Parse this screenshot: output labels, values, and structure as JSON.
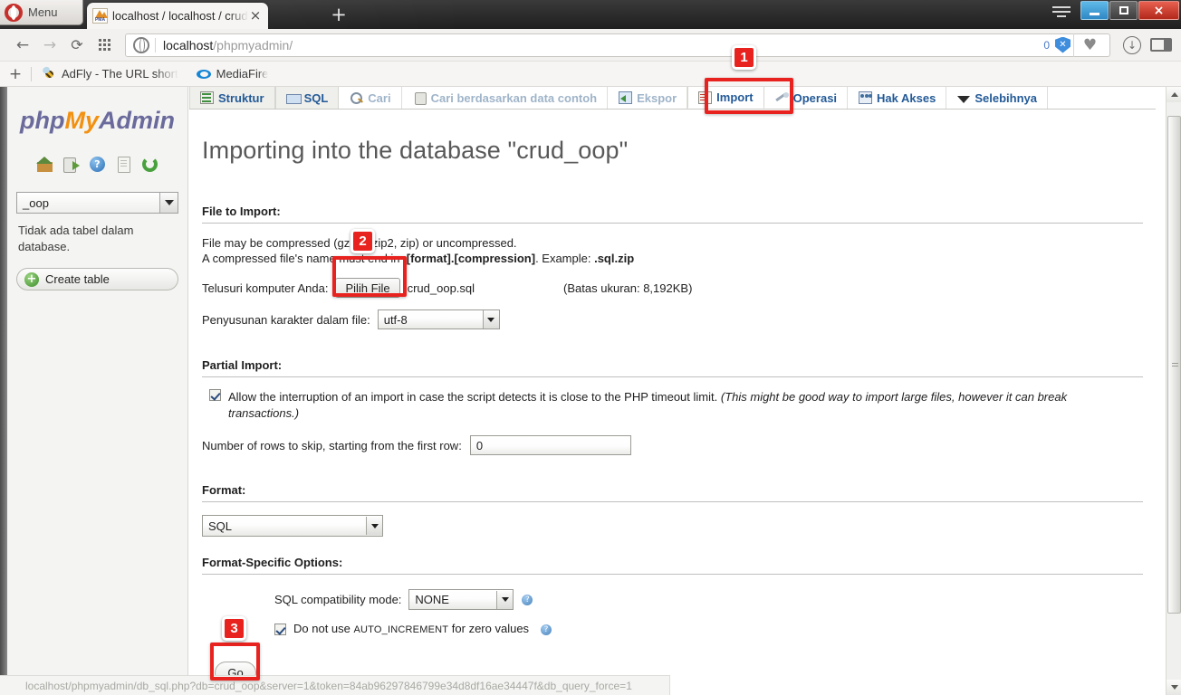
{
  "browser": {
    "menu_label": "Menu",
    "tab": {
      "title": "localhost / localhost / crud",
      "favicon": "phpmyadmin-favicon",
      "close": "×"
    },
    "new_tab": "+",
    "window_controls": {
      "minimize": "minimize-icon",
      "maximize": "maximize-icon",
      "close": "×"
    },
    "nav": {
      "back": "←",
      "forward": "→",
      "reload": "⟳",
      "speeddial": "grid-icon"
    },
    "address": {
      "host": "localhost",
      "path": "/phpmyadmin/",
      "blocked_count": "0",
      "shield": "✕"
    },
    "toolbar_right": {
      "bookmark": "♥",
      "download": "↓",
      "panel": "panel-icon"
    },
    "bookmarks": {
      "add": "+",
      "items": [
        {
          "label": "AdFly - The URL short",
          "icon": "adfly-bee-icon"
        },
        {
          "label": "MediaFire",
          "icon": "mediafire-icon"
        }
      ]
    },
    "statusbar_url": "localhost/phpmyadmin/db_sql.php?db=crud_oop&server=1&token=84ab96297846799e34d8df16ae34447f&db_query_force=1"
  },
  "sidebar": {
    "logo": {
      "php": "php",
      "my": "My",
      "admin": "Admin"
    },
    "icons": [
      {
        "name": "home-icon",
        "label": "Home"
      },
      {
        "name": "logout-icon",
        "label": "Log out"
      },
      {
        "name": "help-icon",
        "label": "?"
      },
      {
        "name": "documentation-icon",
        "label": "Documentation"
      },
      {
        "name": "reload-icon",
        "label": "Reload"
      }
    ],
    "database_select": "_oop",
    "no_tables_note": "Tidak ada tabel dalam database.",
    "create_table": "Create table"
  },
  "pma_tabs": [
    {
      "label": "Struktur",
      "icon": "structure-icon",
      "state": "inactive"
    },
    {
      "label": "SQL",
      "icon": "sql-icon",
      "state": "inactive"
    },
    {
      "label": "Cari",
      "icon": "search-icon",
      "state": "disabled"
    },
    {
      "label": "Cari berdasarkan data contoh",
      "icon": "query-by-example-icon",
      "state": "disabled"
    },
    {
      "label": "Ekspor",
      "icon": "export-icon",
      "state": "disabled"
    },
    {
      "label": "Import",
      "icon": "import-icon",
      "state": "active"
    },
    {
      "label": "Operasi",
      "icon": "operations-icon",
      "state": "disabled"
    },
    {
      "label": "Hak Akses",
      "icon": "privileges-icon",
      "state": "disabled"
    },
    {
      "label": "Selebihnya",
      "icon": "chevron-down-icon",
      "state": "disabled"
    }
  ],
  "main": {
    "title": "Importing into the database \"crud_oop\"",
    "file_to_import": {
      "legend": "File to Import:",
      "note_line1_a": "File may be compressed (gzip, bzip2, zip) or uncompressed.",
      "note_line2_a": "A compressed file's name must end in ",
      "note_line2_b": ".[format].[compression]",
      "note_line2_c": ". Example: ",
      "note_line2_d": ".sql.zip",
      "browse_label": "Telusuri komputer Anda:",
      "browse_button": "Pilih File",
      "file_name": "crud_oop.sql",
      "size_limit": "(Batas ukuran: 8,192KB)",
      "charset_label": "Penyusunan karakter dalam file:",
      "charset_value": "utf-8"
    },
    "partial_import": {
      "legend": "Partial Import:",
      "allow_interrupt_checked": true,
      "allow_interrupt_label": "Allow the interruption of an import in case the script detects it is close to the PHP timeout limit.",
      "allow_interrupt_italic": "(This might be good way to import large files, however it can break transactions.)",
      "skip_rows_label": "Number of rows to skip, starting from the first row:",
      "skip_rows_value": "0"
    },
    "format": {
      "legend": "Format:",
      "value": "SQL"
    },
    "format_specific": {
      "legend": "Format-Specific Options:",
      "compat_label": "SQL compatibility mode:",
      "compat_value": "NONE",
      "compat_help": "?",
      "no_autoinc_checked": true,
      "no_autoinc_label_a": "Do not use ",
      "no_autoinc_label_mono": "AUTO_INCREMENT",
      "no_autoinc_label_b": " for zero values",
      "no_autoinc_help": "?",
      "go_button": "Go"
    }
  },
  "annotations": [
    {
      "number": "1",
      "target": "import-tab"
    },
    {
      "number": "2",
      "target": "pilih-file-button"
    },
    {
      "number": "3",
      "target": "go-button"
    }
  ],
  "colors": {
    "annotation_red": "#e8231f",
    "pma_orange": "#f29111",
    "pma_blue": "#6a6a9c",
    "tab_link": "#235a97"
  }
}
